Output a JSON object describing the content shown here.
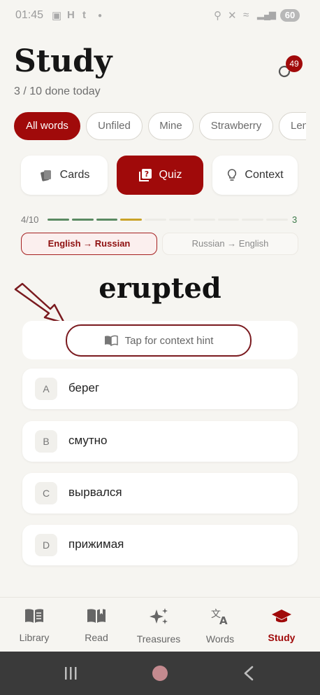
{
  "status_bar": {
    "time": "01:45",
    "battery": "60"
  },
  "header": {
    "title": "Study",
    "subtitle": "3 / 10 done today",
    "badge_count": "49"
  },
  "filters": [
    {
      "label": "All words",
      "active": true
    },
    {
      "label": "Unfiled",
      "active": false
    },
    {
      "label": "Mine",
      "active": false
    },
    {
      "label": "Strawberry",
      "active": false
    },
    {
      "label": "Len",
      "active": false
    }
  ],
  "modes": [
    {
      "label": "Cards",
      "icon": "cards-icon",
      "active": false
    },
    {
      "label": "Quiz",
      "icon": "quiz-icon",
      "active": true
    },
    {
      "label": "Context",
      "icon": "lightbulb-icon",
      "active": false
    }
  ],
  "progress": {
    "label": "4/10",
    "count": "3",
    "segments": [
      "#5a8a62",
      "#5a8a62",
      "#5a8a62",
      "#c9a227",
      "#ecebe6",
      "#ecebe6",
      "#ecebe6",
      "#ecebe6",
      "#ecebe6",
      "#ecebe6"
    ]
  },
  "direction": {
    "active": "English → Russian",
    "inactive": "Russian → English"
  },
  "quiz": {
    "word": "erupted",
    "hint": "Tap for context hint",
    "options": [
      {
        "letter": "A",
        "text": "берег"
      },
      {
        "letter": "B",
        "text": "смутно"
      },
      {
        "letter": "C",
        "text": "вырвался"
      },
      {
        "letter": "D",
        "text": "прижимая"
      }
    ]
  },
  "nav": [
    {
      "label": "Library",
      "icon": "library-icon",
      "active": false
    },
    {
      "label": "Read",
      "icon": "read-icon",
      "active": false
    },
    {
      "label": "Treasures",
      "icon": "sparkles-icon",
      "active": false
    },
    {
      "label": "Words",
      "icon": "translate-icon",
      "active": false
    },
    {
      "label": "Study",
      "icon": "graduation-cap-icon",
      "active": true
    }
  ],
  "colors": {
    "accent": "#a00a0a",
    "annotation": "#7a1a1f",
    "progress_done": "#5a8a62",
    "progress_current": "#c9a227"
  }
}
